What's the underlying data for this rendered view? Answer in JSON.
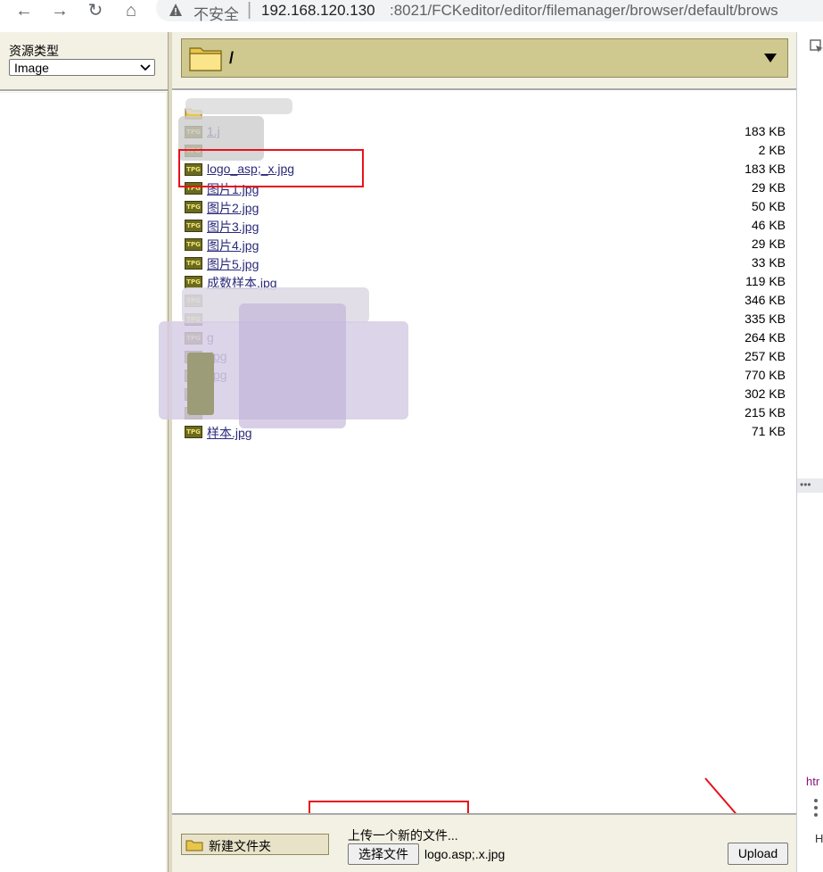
{
  "browser": {
    "back_glyph": "←",
    "forward_glyph": "→",
    "reload_glyph": "↻",
    "home_glyph": "⌂",
    "insecure_label": "不安全",
    "url_host": "192.168.120.130",
    "url_path": ":8021/FCKeditor/editor/filemanager/browser/default/brows"
  },
  "left_panel": {
    "resource_type_label": "资源类型",
    "resource_type_value": "Image"
  },
  "folder_header": {
    "current_path": "/"
  },
  "files": [
    {
      "name": "",
      "size": "",
      "type": "folder"
    },
    {
      "name": "1.j",
      "size": "183 KB",
      "type": "jpg"
    },
    {
      "name": "",
      "size": "2 KB",
      "type": "jpg"
    },
    {
      "name": "logo_asp;_x.jpg",
      "size": "183 KB",
      "type": "jpg"
    },
    {
      "name": "图片1.jpg",
      "size": "29 KB",
      "type": "jpg"
    },
    {
      "name": "图片2.jpg",
      "size": "50 KB",
      "type": "jpg"
    },
    {
      "name": "图片3.jpg",
      "size": "46 KB",
      "type": "jpg"
    },
    {
      "name": "图片4.jpg",
      "size": "29 KB",
      "type": "jpg"
    },
    {
      "name": "图片5.jpg",
      "size": "33 KB",
      "type": "jpg"
    },
    {
      "name": "成数样本.jpg",
      "size": "119 KB",
      "type": "jpg"
    },
    {
      "name": "",
      "size": "346 KB",
      "type": "jpg"
    },
    {
      "name": "",
      "size": "335 KB",
      "type": "jpg"
    },
    {
      "name": "g",
      "size": "264 KB",
      "type": "jpg"
    },
    {
      "name": ".jpg",
      "size": "257 KB",
      "type": "jpg"
    },
    {
      "name": ".jpg",
      "size": "770 KB",
      "type": "jpg"
    },
    {
      "name": "",
      "size": "302 KB",
      "type": "jpg"
    },
    {
      "name": "",
      "size": "215 KB",
      "type": "jpg"
    },
    {
      "name": "样本.jpg",
      "size": "71 KB",
      "type": "jpg"
    }
  ],
  "icon_text": "TPG",
  "bottom_bar": {
    "new_folder_label": "新建文件夹",
    "upload_title": "上传一个新的文件...",
    "choose_file_label": "选择文件",
    "chosen_file_name": "logo.asp;.x.jpg",
    "upload_label": "Upload"
  },
  "devtools": {
    "html_fragment": "htr",
    "h_letter": "H"
  },
  "colors": {
    "panel_bg": "#f3f1e4",
    "header_olive": "#cfc88f",
    "link": "#2a2a7a",
    "annotation_red": "#e8111a"
  }
}
